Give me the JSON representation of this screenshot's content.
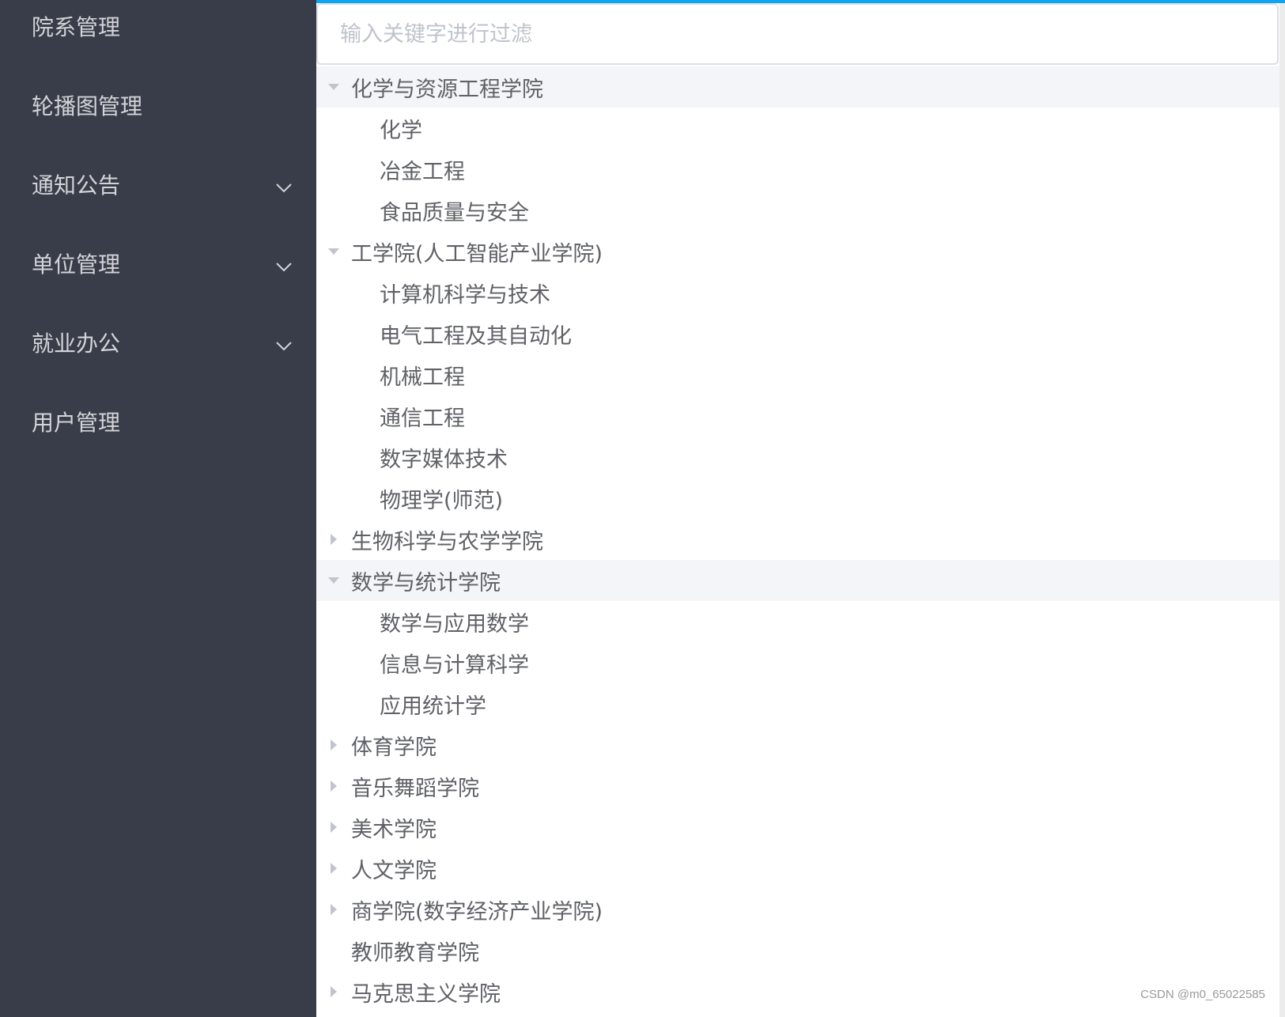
{
  "sidebar": {
    "items": [
      {
        "label": "院系管理",
        "has_submenu": false
      },
      {
        "label": "轮播图管理",
        "has_submenu": false
      },
      {
        "label": "通知公告",
        "has_submenu": true
      },
      {
        "label": "单位管理",
        "has_submenu": true
      },
      {
        "label": "就业办公",
        "has_submenu": true
      },
      {
        "label": "用户管理",
        "has_submenu": false
      }
    ]
  },
  "search": {
    "placeholder": "输入关键字进行过滤",
    "value": ""
  },
  "tree": {
    "nodes": [
      {
        "label": "化学与资源工程学院",
        "level": 1,
        "state": "expanded",
        "highlight": true
      },
      {
        "label": "化学",
        "level": 2
      },
      {
        "label": "冶金工程",
        "level": 2
      },
      {
        "label": "食品质量与安全",
        "level": 2
      },
      {
        "label": "工学院(人工智能产业学院)",
        "level": 1,
        "state": "expanded"
      },
      {
        "label": "计算机科学与技术",
        "level": 2
      },
      {
        "label": "电气工程及其自动化",
        "level": 2
      },
      {
        "label": "机械工程",
        "level": 2
      },
      {
        "label": "通信工程",
        "level": 2
      },
      {
        "label": "数字媒体技术",
        "level": 2
      },
      {
        "label": "物理学(师范)",
        "level": 2
      },
      {
        "label": "生物科学与农学学院",
        "level": 1,
        "state": "collapsed"
      },
      {
        "label": "数学与统计学院",
        "level": 1,
        "state": "expanded",
        "highlight": true
      },
      {
        "label": "数学与应用数学",
        "level": 2
      },
      {
        "label": "信息与计算科学",
        "level": 2
      },
      {
        "label": "应用统计学",
        "level": 2
      },
      {
        "label": "体育学院",
        "level": 1,
        "state": "collapsed"
      },
      {
        "label": "音乐舞蹈学院",
        "level": 1,
        "state": "collapsed"
      },
      {
        "label": "美术学院",
        "level": 1,
        "state": "collapsed"
      },
      {
        "label": "人文学院",
        "level": 1,
        "state": "collapsed"
      },
      {
        "label": "商学院(数字经济产业学院)",
        "level": 1,
        "state": "collapsed"
      },
      {
        "label": "教师教育学院",
        "level": 1,
        "state": "leaf"
      },
      {
        "label": "马克思主义学院",
        "level": 1,
        "state": "collapsed"
      }
    ]
  },
  "watermark": "CSDN @m0_65022585",
  "colors": {
    "sidebar_bg": "#393d49",
    "accent": "#0ea5ee",
    "highlight_row": "#f4f5f8"
  }
}
